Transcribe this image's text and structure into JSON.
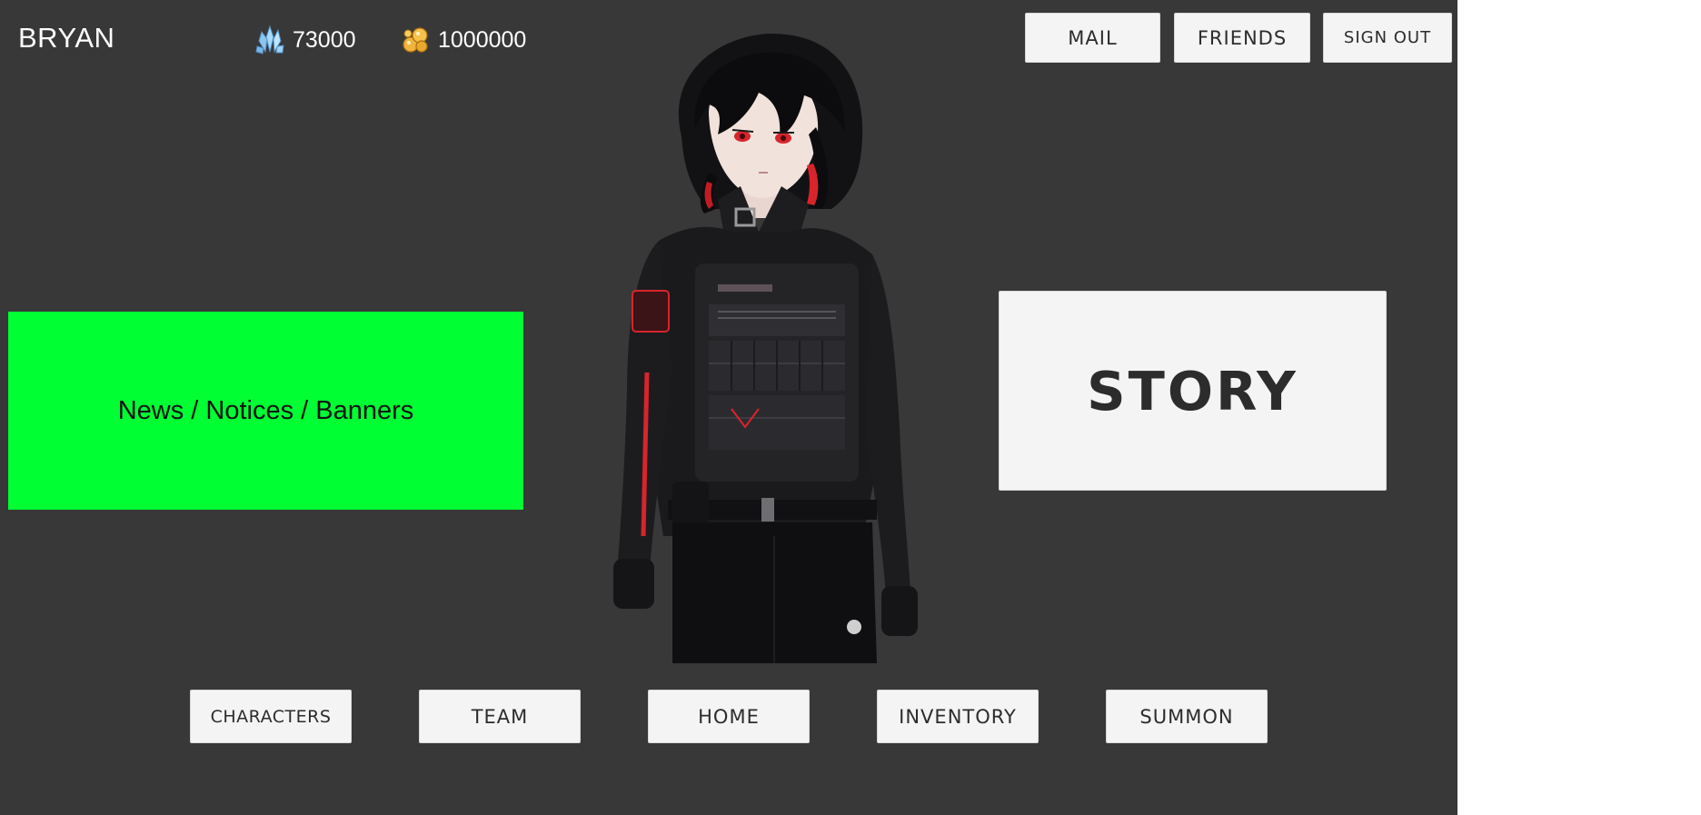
{
  "player": {
    "name": "BRYAN"
  },
  "currencies": {
    "gems": {
      "icon": "crystal-icon",
      "value": "73000",
      "color": "#8fc8ee"
    },
    "gold": {
      "icon": "gold-nugget-icon",
      "value": "1000000",
      "color": "#e8a92c"
    }
  },
  "top_menu": {
    "mail": "MAIL",
    "friends": "FRIENDS",
    "sign_out": "SIGN OUT"
  },
  "news_panel": {
    "label": "News / Notices / Banners",
    "color": "#00ff33"
  },
  "story_button": {
    "label": "STORY"
  },
  "bottom_nav": {
    "characters": "CHARACTERS",
    "team": "TEAM",
    "home": "HOME",
    "inventory": "INVENTORY",
    "summon": "SUMMON"
  },
  "colors": {
    "background": "#383838",
    "button_bg": "#f4f4f4",
    "button_text": "#2c2c2c",
    "accent_red": "#d8242c"
  }
}
